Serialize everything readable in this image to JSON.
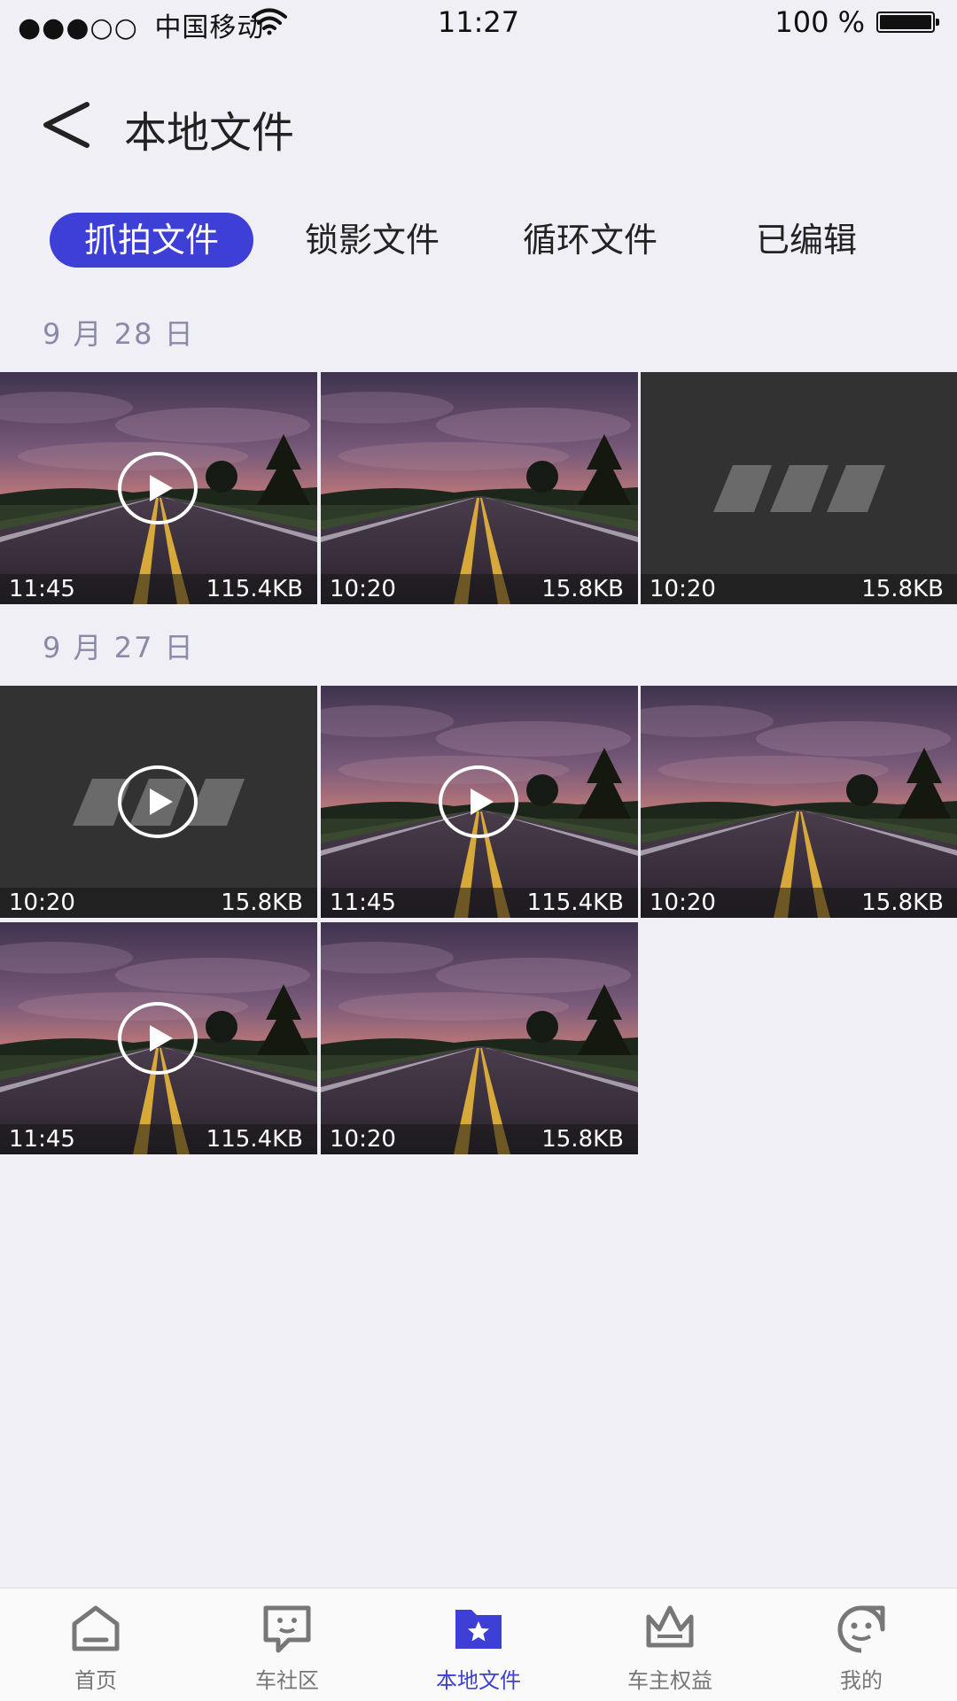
{
  "status_bar": {
    "signal_dots": "●●●○○",
    "carrier": "中国移动",
    "time": "11:27",
    "battery_text": "100 %"
  },
  "header": {
    "title": "本地文件"
  },
  "tabs": [
    {
      "label": "抓拍文件",
      "active": true
    },
    {
      "label": "锁影文件",
      "active": false
    },
    {
      "label": "循环文件",
      "active": false
    },
    {
      "label": "已编辑",
      "active": false
    }
  ],
  "sections": [
    {
      "date": "9 月 28 日",
      "items": [
        {
          "time": "11:45",
          "size": "115.4KB",
          "type": "video",
          "thumb": "road"
        },
        {
          "time": "10:20",
          "size": "15.8KB",
          "type": "photo",
          "thumb": "road"
        },
        {
          "time": "10:20",
          "size": "15.8KB",
          "type": "photo",
          "thumb": "placeholder"
        }
      ]
    },
    {
      "date": "9 月 27 日",
      "items": [
        {
          "time": "10:20",
          "size": "15.8KB",
          "type": "video",
          "thumb": "placeholder"
        },
        {
          "time": "11:45",
          "size": "115.4KB",
          "type": "video",
          "thumb": "road"
        },
        {
          "time": "10:20",
          "size": "15.8KB",
          "type": "photo",
          "thumb": "road"
        },
        {
          "time": "11:45",
          "size": "115.4KB",
          "type": "video",
          "thumb": "road"
        },
        {
          "time": "10:20",
          "size": "15.8KB",
          "type": "photo",
          "thumb": "road"
        }
      ]
    }
  ],
  "bottom_nav": [
    {
      "label": "首页",
      "icon": "home-icon",
      "active": false
    },
    {
      "label": "车社区",
      "icon": "chat-icon",
      "active": false
    },
    {
      "label": "本地文件",
      "icon": "folder-star-icon",
      "active": true
    },
    {
      "label": "车主权益",
      "icon": "crown-icon",
      "active": false
    },
    {
      "label": "我的",
      "icon": "smile-face-icon",
      "active": false
    }
  ],
  "colors": {
    "accent": "#3e3fd6",
    "background": "#f0eff5",
    "date_label": "#8a8aa8",
    "nav_inactive": "#777777"
  }
}
